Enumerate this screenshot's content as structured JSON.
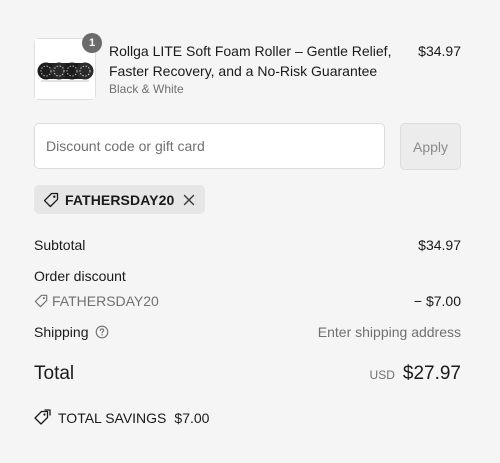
{
  "product": {
    "quantity": "1",
    "title": "Rollga LITE Soft Foam Roller – Gentle Relief, Faster Recovery, and a No-Risk Guarantee",
    "variant": "Black & White",
    "price": "$34.97"
  },
  "discount": {
    "placeholder": "Discount code or gift card",
    "apply_label": "Apply",
    "applied_code": "FATHERSDAY20"
  },
  "summary": {
    "subtotal_label": "Subtotal",
    "subtotal_value": "$34.97",
    "order_discount_label": "Order discount",
    "discount_code": "FATHERSDAY20",
    "discount_value": "− $7.00",
    "shipping_label": "Shipping",
    "shipping_value": "Enter shipping address",
    "total_label": "Total",
    "currency": "USD",
    "total_value": "$27.97",
    "savings_label": "TOTAL SAVINGS",
    "savings_value": "$7.00"
  },
  "icons": {
    "tag": "tag-icon",
    "remove": "close-icon",
    "help": "help-icon",
    "savings": "tags-icon"
  },
  "colors": {
    "background": "#f5f5f5",
    "text": "#1a1a1a",
    "muted": "#707070",
    "chip": "#e6e6e6",
    "badge": "#6b6b6b"
  }
}
